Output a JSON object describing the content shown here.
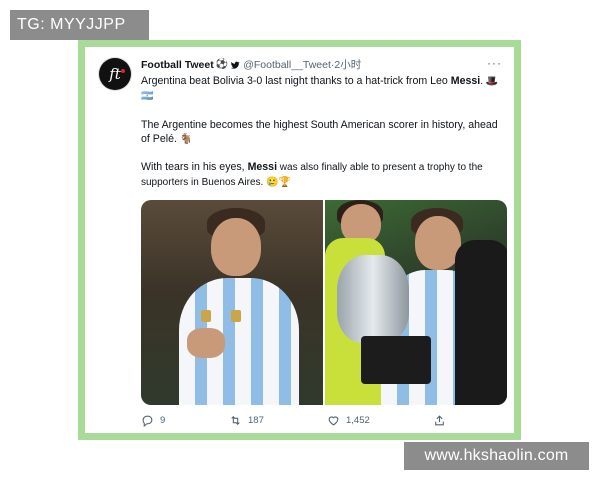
{
  "watermark_top": "TG: MYYJJPP",
  "watermark_bottom": "www.hkshaolin.com",
  "colors": {
    "frame": "#a9db98",
    "badge": "#8c8c8c",
    "twitter_blue": "#1d9bf0",
    "muted": "#536471"
  },
  "tweet": {
    "avatar_text": "ft",
    "author_name": "Football Tweet",
    "author_emoji": "⚽",
    "verified_icon": "twitter-bird-icon",
    "handle": "@Football__Tweet",
    "separator": " · ",
    "time": "2小时",
    "more": "···",
    "para1_a": "Argentina beat Bolivia 3-0 last night thanks to a hat-trick from Leo ",
    "para1_bold": "Messi",
    "para1_b": ". 🎩🇦🇷",
    "para2": "The Argentine becomes the highest South American scorer in history, ahead of Pelé. 🐐",
    "para3_a": "With tears in his eyes, ",
    "para3_bold": "Messi",
    "para3_b": " was also finally able to present a trophy to the supporters in Buenos Aires. 🥲🏆",
    "media": [
      {
        "icon": "photo-messi-hand-on-heart"
      },
      {
        "icon": "photo-messi-with-trophy"
      }
    ],
    "actions": {
      "replies": "9",
      "retweets": "187",
      "likes": "1,452",
      "share": ""
    }
  }
}
